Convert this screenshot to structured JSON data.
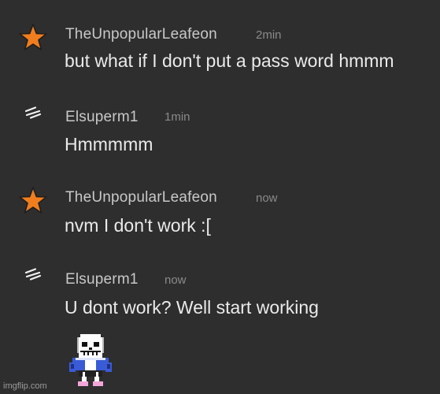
{
  "messages": [
    {
      "author": "TheUnpopularLeafeon",
      "time": "2min",
      "text": "but what if I don't put a pass word hmmm",
      "avatar_icon": "orange-star-icon"
    },
    {
      "author": "Elsuperm1",
      "time": "1min",
      "text": "Hmmmmm",
      "avatar_icon": "lightning-bolt-icon"
    },
    {
      "author": "TheUnpopularLeafeon",
      "time": "now",
      "text": "nvm I don't work :[",
      "avatar_icon": "orange-star-icon"
    },
    {
      "author": "Elsuperm1",
      "time": "now",
      "text": "U dont work? Well start working",
      "avatar_icon": "lightning-bolt-icon"
    }
  ],
  "sticker": {
    "icon": "skeleton-sticker-icon"
  },
  "watermark": "imgflip.com",
  "colors": {
    "background": "#2e2e2e",
    "star": "#f07d1e",
    "author": "#c8c8c8",
    "timestamp": "#8a8a8a",
    "message": "#eaeaea"
  }
}
